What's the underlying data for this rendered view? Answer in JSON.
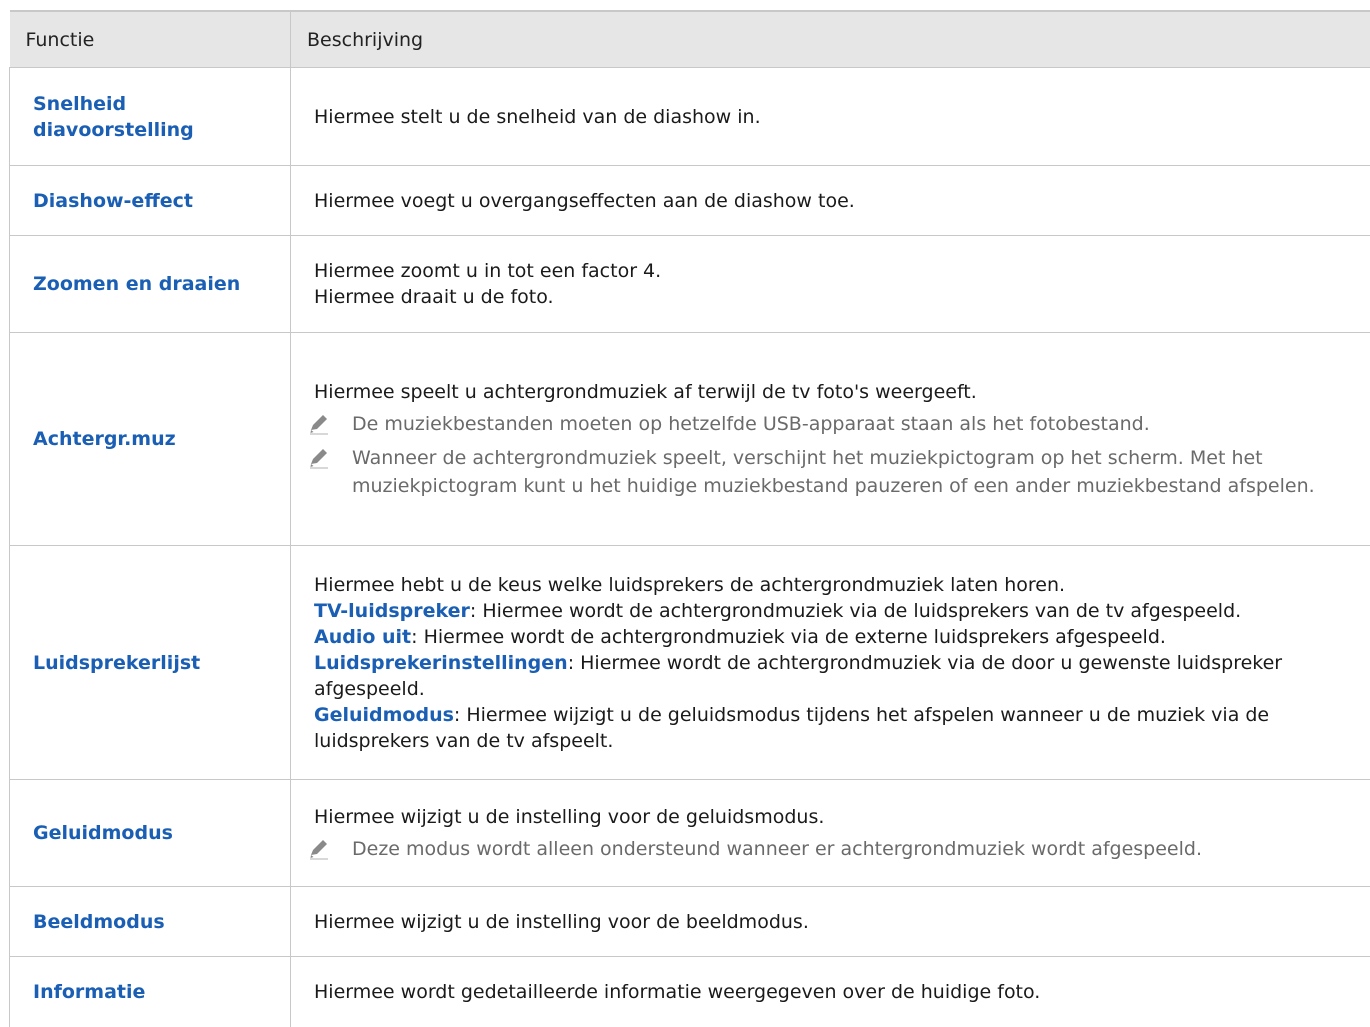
{
  "header": {
    "col1": "Functie",
    "col2": "Beschrijving"
  },
  "rows": [
    {
      "name": "Snelheid diavoorstelling",
      "desc": "Hiermee stelt u de snelheid van de diashow in."
    },
    {
      "name": "Diashow-effect",
      "desc": "Hiermee voegt u overgangseffecten aan de diashow toe."
    },
    {
      "name": "Zoomen en draaien",
      "desc1": "Hiermee zoomt u in tot een factor 4.",
      "desc2": "Hiermee draait u de foto."
    },
    {
      "name": "Achtergr.muz",
      "desc": "Hiermee speelt u achtergrondmuziek af terwijl de tv foto's weergeeft.",
      "note1": "De muziekbestanden moeten op hetzelfde USB-apparaat staan als het fotobestand.",
      "note2": "Wanneer de achtergrondmuziek speelt, verschijnt het muziekpictogram op het scherm. Met het muziekpictogram kunt u het huidige muziekbestand pauzeren of een ander muziekbestand afspelen."
    },
    {
      "name": "Luidsprekerlijst",
      "desc": "Hiermee hebt u de keus welke luidsprekers de achtergrondmuziek laten horen.",
      "items": [
        {
          "term": "TV-luidspreker",
          "text": ": Hiermee wordt de achtergrondmuziek via de luidsprekers van de tv afgespeeld."
        },
        {
          "term": "Audio uit",
          "text": ": Hiermee wordt de achtergrondmuziek via de externe luidsprekers afgespeeld."
        },
        {
          "term": "Luidsprekerinstellingen",
          "text": ": Hiermee wordt de achtergrondmuziek via de door u gewenste luidspreker afgespeeld."
        },
        {
          "term": "Geluidmodus",
          "text": ": Hiermee wijzigt u de geluidsmodus tijdens het afspelen wanneer u de muziek via de luidsprekers van de tv afspeelt."
        }
      ]
    },
    {
      "name": "Geluidmodus",
      "desc": "Hiermee wijzigt u de instelling voor de geluidsmodus.",
      "note1": "Deze modus wordt alleen ondersteund wanneer er achtergrondmuziek wordt afgespeeld."
    },
    {
      "name": "Beeldmodus",
      "desc": "Hiermee wijzigt u de instelling voor de beeldmodus."
    },
    {
      "name": "Informatie",
      "desc": "Hiermee wordt gedetailleerde informatie weergegeven over de huidige foto."
    }
  ],
  "colors": {
    "accent": "#1a5fb4",
    "note": "#6a6a6a",
    "header_bg": "#e6e6e6",
    "border": "#c8c8c8"
  },
  "icons": {
    "note": "pencil-icon"
  }
}
